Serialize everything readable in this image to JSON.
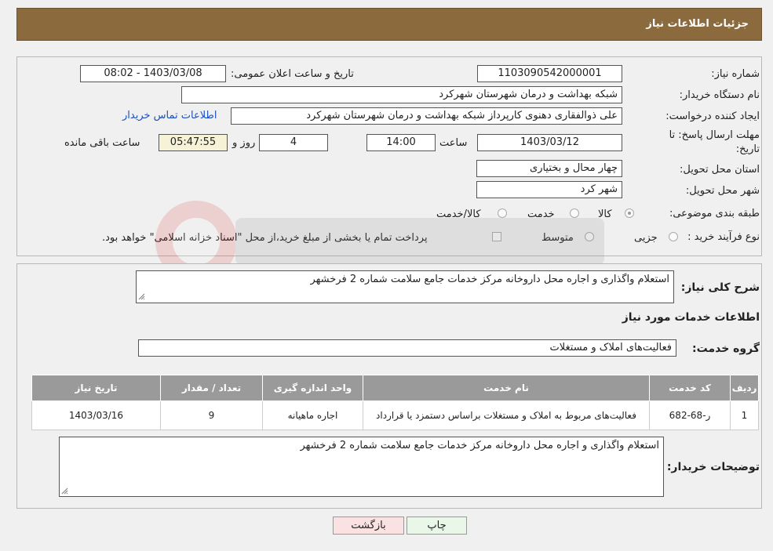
{
  "header": {
    "title": "جزئیات اطلاعات نیاز"
  },
  "form": {
    "need_number_label": "شماره نیاز:",
    "need_number": "1103090542000001",
    "announce_label": "تاریخ و ساعت اعلان عمومی:",
    "announce_value": "1403/03/08 - 08:02",
    "buyer_org_label": "نام دستگاه خریدار:",
    "buyer_org": "شبکه بهداشت و درمان شهرستان شهرکرد",
    "requester_label": "ایجاد کننده درخواست:",
    "requester": "علی ذوالفقاری دهنوی کارپرداز شبکه بهداشت و درمان شهرستان شهرکرد",
    "contact_link": "اطلاعات تماس خریدار",
    "deadline_label_1": "مهلت ارسال پاسخ: تا",
    "deadline_label_2": "تاریخ:",
    "deadline_date": "1403/03/12",
    "time_label": "ساعت",
    "deadline_time": "14:00",
    "days_value": "4",
    "days_label": "روز و",
    "remaining_value": "05:47:55",
    "remaining_label": "ساعت باقی مانده",
    "province_label": "استان محل تحویل:",
    "province": "چهار محال و بختیاری",
    "city_label": "شهر محل تحویل:",
    "city": "شهر کرد",
    "category_label": "طبقه بندی موضوعی:",
    "category_options": [
      "کالا",
      "خدمت",
      "کالا/خدمت"
    ],
    "category_selected": "کالا",
    "process_label": "نوع فرآیند خرید :",
    "process_options": [
      "جزیی",
      "متوسط"
    ],
    "payment_note": "پرداخت تمام یا بخشی از مبلغ خرید،از محل \"اسناد خزانه اسلامی\" خواهد بود."
  },
  "summary": {
    "label": "شرح کلی نیاز:",
    "text": "استعلام واگذاری و اجاره محل داروخانه مرکز خدمات جامع سلامت شماره 2 فرخشهر",
    "services_heading": "اطلاعات خدمات مورد نیاز",
    "group_label": "گروه خدمت:",
    "group_value": "فعالیت‌های  املاک و مستغلات"
  },
  "table": {
    "headers": [
      "ردیف",
      "کد خدمت",
      "نام خدمت",
      "واحد اندازه گیری",
      "تعداد / مقدار",
      "تاریخ نیاز"
    ],
    "rows": [
      [
        "1",
        "ر-68-682",
        "فعالیت‌های مربوط به املاک و مستغلات براساس دستمزد یا قرارداد",
        "اجاره ماهیانه",
        "9",
        "1403/03/16"
      ]
    ]
  },
  "buyer_notes": {
    "label": "توضیحات خریدار:",
    "text": "استعلام واگذاری و اجاره محل داروخانه مرکز خدمات جامع سلامت شماره 2 فرخشهر"
  },
  "buttons": {
    "print": "چاپ",
    "back": "بازگشت"
  },
  "colors": {
    "header_bg": "#8b6a3e",
    "table_header_bg": "#9a9a9a",
    "link": "#1a4fc4",
    "back_btn_bg": "#fbe2e2",
    "print_btn_bg": "#e8f7e8"
  }
}
